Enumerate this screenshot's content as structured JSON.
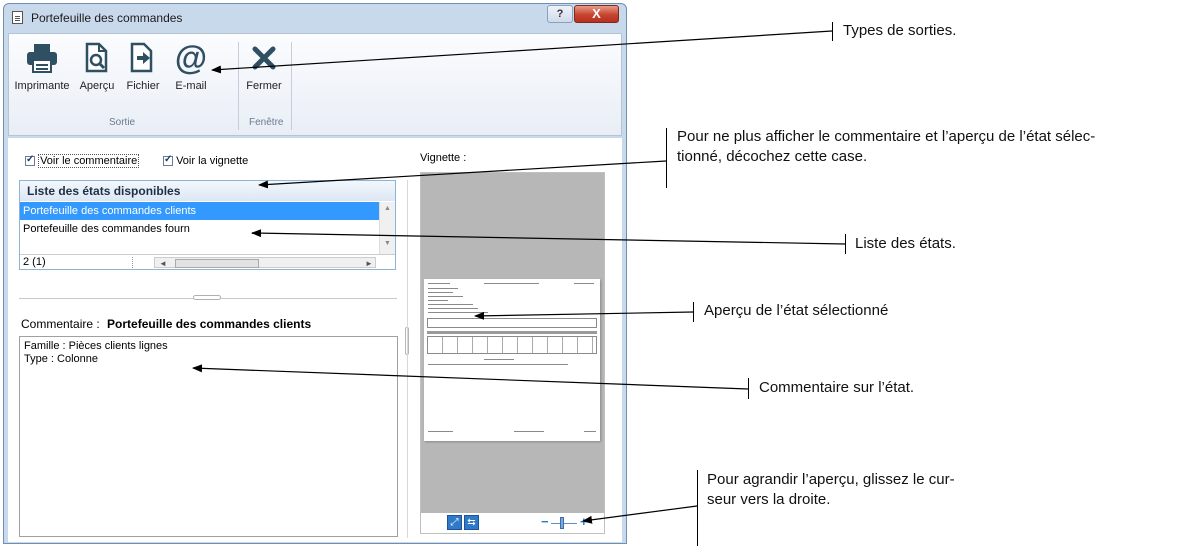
{
  "window": {
    "title": "Portefeuille des commandes",
    "help_label": "?",
    "close_label": "X"
  },
  "ribbon": {
    "buttons": [
      {
        "label": "Imprimante",
        "icon": "printer-icon"
      },
      {
        "label": "Aperçu",
        "icon": "preview-icon"
      },
      {
        "label": "Fichier",
        "icon": "export-file-icon"
      },
      {
        "label": "E-mail",
        "icon": "at-sign-icon"
      },
      {
        "label": "Fermer",
        "icon": "close-x-icon"
      }
    ],
    "groups": [
      "Sortie",
      "Fenêtre"
    ]
  },
  "options": {
    "show_comment": {
      "label": "Voir le commentaire",
      "checked": true
    },
    "show_thumbnail": {
      "label": "Voir la vignette",
      "checked": true
    }
  },
  "reports": {
    "header": "Liste des états disponibles",
    "items": [
      "Portefeuille des commandes clients",
      "Portefeuille des commandes fourn"
    ],
    "selected_index": 0,
    "count": "2 (1)"
  },
  "comment": {
    "label": "Commentaire :",
    "title": "Portefeuille des commandes clients",
    "lines": [
      "Famille : Pièces clients lignes",
      "Type : Colonne"
    ]
  },
  "thumbnail": {
    "label": "Vignette :",
    "zoom_minus": "−",
    "zoom_plus": "+"
  },
  "annotations": [
    {
      "text": "Types de sorties."
    },
    {
      "text": "Pour ne plus afficher le commentaire et l’aperçu de l’état sélec-",
      "text2": "tionné, décochez cette case."
    },
    {
      "text": "Liste des états."
    },
    {
      "text": "Aperçu de l’état sélectionné"
    },
    {
      "text": "Commentaire sur l’état."
    },
    {
      "text": "Pour agrandir l’aperçu, glissez le cur-",
      "text2": "seur vers la droite."
    }
  ],
  "colors": {
    "selection": "#3399ff",
    "window_frame": "#c9d9ec",
    "close_button": "#c6442f"
  }
}
